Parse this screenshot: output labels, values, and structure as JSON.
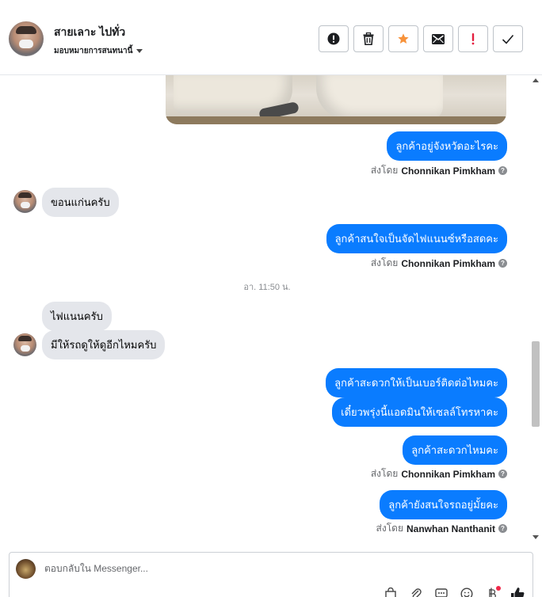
{
  "header": {
    "contact_name": "สายเลาะ ไปทั่ว",
    "assign_label": "มอบหมายการสนทนานี้"
  },
  "actions": [
    {
      "name": "mark-spam",
      "icon": "alert-circle-icon"
    },
    {
      "name": "delete",
      "icon": "trash-icon"
    },
    {
      "name": "star",
      "icon": "star-icon",
      "color": "#f7923a"
    },
    {
      "name": "mark-unread",
      "icon": "envelope-icon"
    },
    {
      "name": "follow-up",
      "icon": "exclamation-icon",
      "color": "#e41e3f"
    },
    {
      "name": "mark-done",
      "icon": "check-icon"
    }
  ],
  "messages": {
    "m1": "ลูกค้าอยู่จังหวัดอะไรคะ",
    "m1_sent_prefix": "ส่งโดย",
    "m1_sender": "Chonnikan Pimkham",
    "m2": "ขอนแก่นครับ",
    "m3": "ลูกค้าสนใจเป็นจัดไฟแนนซ์หรือสดคะ",
    "m3_sent_prefix": "ส่งโดย",
    "m3_sender": "Chonnikan Pimkham",
    "timestamp": "อา. 11:50 น.",
    "m4": "ไฟแนนครับ",
    "m5": "มีให้รถดูให้ดูอีกไหมครับ",
    "m6": "ลูกค้าสะดวกให้เป็นเบอร์ติดต่อไหมคะ",
    "m7": "เดี๋ยวพรุ่งนี้แอดมินให้เซลล์โทรหาคะ",
    "m8": "ลูกค้าสะดวกไหมคะ",
    "m8_sent_prefix": "ส่งโดย",
    "m8_sender": "Chonnikan Pimkham",
    "m9": "ลูกค้ายังสนใจรถอยู่มั้ยคะ",
    "m9_sent_prefix": "ส่งโดย",
    "m9_sender": "Nanwhan Nanthanit"
  },
  "composer": {
    "placeholder": "ตอบกลับใน Messenger..."
  },
  "colors": {
    "outgoing_bubble": "#0a7cff",
    "incoming_bubble": "#e4e6eb"
  }
}
